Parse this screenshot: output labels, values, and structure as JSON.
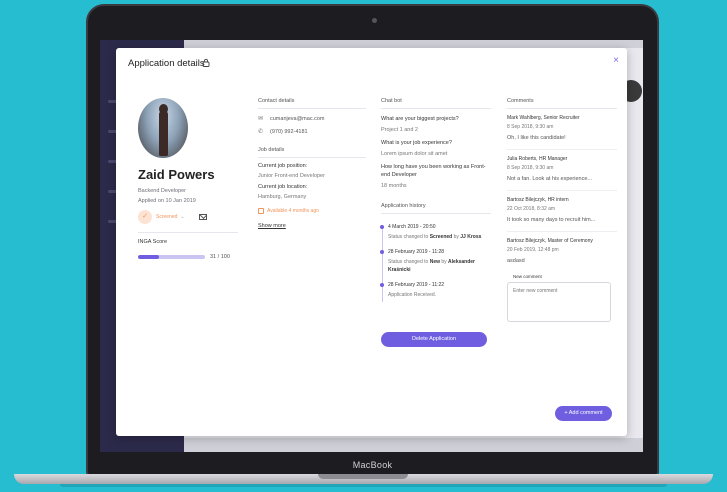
{
  "laptop": {
    "brand": "MacBook"
  },
  "modal": {
    "title": "Application details",
    "close": "×"
  },
  "candidate": {
    "name": "Zaid Powers",
    "role": "Backend Developer",
    "applied": "Applied on 10 Jan 2019",
    "status": "Screened",
    "score_label": "INGA Score",
    "score_value": 31,
    "score_max": 100,
    "score_text": "31 / 100"
  },
  "contact": {
    "heading": "Contact details",
    "email": "cumanjeva@mac.com",
    "phone": "(970) 992-4181"
  },
  "job": {
    "heading": "Job details",
    "current_position_label": "Current job position:",
    "current_position": "Junior Front-end Developer",
    "location_label": "Current job location:",
    "location": "Hamburg, Germany",
    "availability": "Available 4 months ago",
    "show_more": "Show more"
  },
  "chatbot": {
    "heading": "Chat bot",
    "qa": [
      {
        "q": "What are your biggest projects?",
        "a": "Project 1 and 2"
      },
      {
        "q": "What is your job experience?",
        "a": "Lorem ipsum dolor sit amet"
      },
      {
        "q": "How long have you been working as Front-end Developer",
        "a": "18 months"
      }
    ]
  },
  "history": {
    "heading": "Application history",
    "items": [
      {
        "date": "4 March 2019 - 20:50",
        "prefix": "Status changed to ",
        "status": "Screened",
        "mid": " by ",
        "actor": "JJ Kross"
      },
      {
        "date": "28 February 2019 - 11:28",
        "prefix": "Status changed to ",
        "status": "New",
        "mid": " by ",
        "actor": "Aleksander Kraśnicki"
      },
      {
        "date": "28 February 2019 - 11:22",
        "text": "Application Received."
      }
    ],
    "delete_button": "Delete Application"
  },
  "comments": {
    "heading": "Comments",
    "items": [
      {
        "author": "Mark Wahlberg, Senior Recruiter",
        "date": "8 Sep 2018, 9:30 am",
        "text": "Oh, I like this candidate!"
      },
      {
        "author": "Julia Roberts, HR Manager",
        "date": "8 Sep 2018, 9:30 am",
        "text": "Not a fan. Look at his experience..."
      },
      {
        "author": "Bartosz Bilejczyk, HR intern",
        "date": "22 Oct 2018, 8:32 am",
        "text": "It took so many days to recruit him..."
      },
      {
        "author": "Bartosz Bilejczyk, Master of Ceremony",
        "date": "20 Feb 2019, 12:48 pm",
        "text": "asdasd"
      }
    ],
    "new_label": "New comment",
    "new_placeholder": "Enter new comment",
    "add_button": "+ Add comment"
  },
  "colors": {
    "accent": "#6f5fe0",
    "status": "#f0955a",
    "background": "#27bdd0"
  }
}
